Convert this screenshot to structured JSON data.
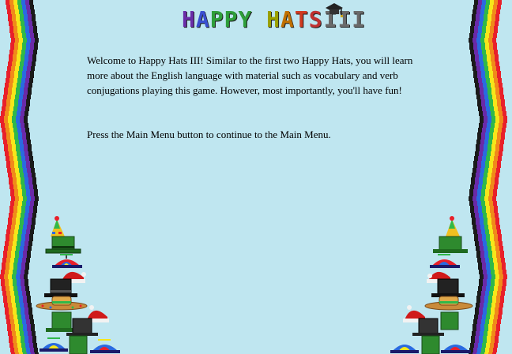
{
  "title": {
    "text": "HAPPY HATS",
    "numeral": "III",
    "letter_colors": [
      "#6a2da8",
      "#3a4fd0",
      "#2e9e3a",
      "#2e9e3a",
      "#2e9e3a",
      "#9aa000",
      "#c07000",
      "#d03a20",
      "#c03030",
      "#6a6a6a"
    ],
    "icon": "graduation-cap-icon"
  },
  "intro_text": "Welcome to Happy Hats III! Similar to the first two Happy Hats, you will learn more about the English language with material such as vocabulary and verb conjugations playing this game. However, most importantly, you'll have fun!",
  "instruction_text": "Press the Main Menu button to continue to the Main Menu.",
  "colors": {
    "background": "#bfe6f0",
    "rainbow": [
      "#e8202a",
      "#f08a1a",
      "#f6e61a",
      "#2fb84a",
      "#2a6ae0",
      "#6a2aa8",
      "#1a1a1a"
    ]
  },
  "decorations": {
    "left_hat_stack": [
      "party-hat-icon",
      "green-top-hat-icon",
      "propeller-cap-icon",
      "santa-hat-icon",
      "black-top-hat-icon",
      "sombrero-icon",
      "green-top-hat-icon",
      "black-top-hat-icon",
      "santa-hat-icon",
      "propeller-cap-icon"
    ],
    "right_hat_stack": [
      "party-hat-icon",
      "green-top-hat-icon",
      "propeller-cap-icon",
      "santa-hat-icon",
      "black-top-hat-icon",
      "sombrero-icon",
      "santa-hat-icon",
      "black-top-hat-icon",
      "propeller-cap-icon"
    ]
  }
}
